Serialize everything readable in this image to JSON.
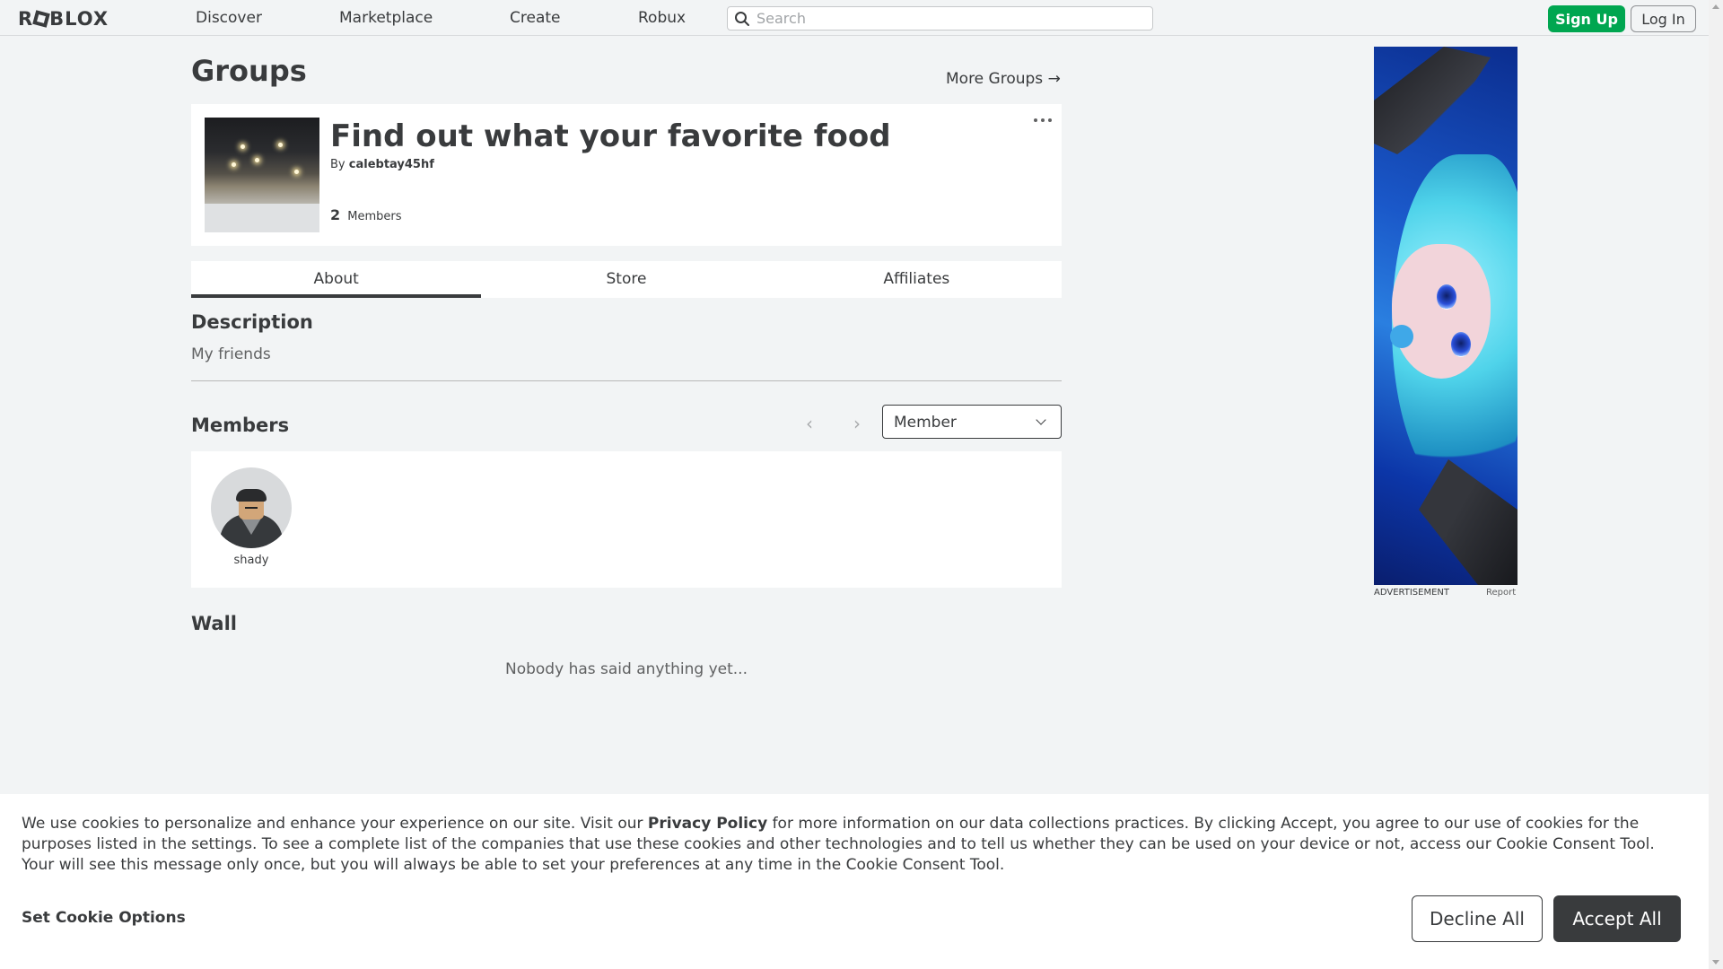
{
  "nav": {
    "logo": "ROBLOX",
    "links": [
      "Discover",
      "Marketplace",
      "Create",
      "Robux"
    ],
    "search_placeholder": "Search",
    "signup_label": "Sign Up",
    "login_label": "Log In"
  },
  "page": {
    "title": "Groups",
    "more_groups": "More Groups →"
  },
  "group": {
    "name": "Find out what your favorite food",
    "by_prefix": "By",
    "owner": "calebtay45hf",
    "member_count": "2",
    "members_label": "Members"
  },
  "tabs": [
    {
      "label": "About",
      "active": true
    },
    {
      "label": "Store",
      "active": false
    },
    {
      "label": "Affiliates",
      "active": false
    }
  ],
  "description": {
    "heading": "Description",
    "text": "My friends"
  },
  "members": {
    "heading": "Members",
    "role_selected": "Member",
    "list": [
      {
        "name": "shady"
      }
    ]
  },
  "wall": {
    "heading": "Wall",
    "empty_text": "Nobody has said anything yet..."
  },
  "ad": {
    "label": "ADVERTISEMENT",
    "report": "Report"
  },
  "cookie": {
    "text_before": "We use cookies to personalize and enhance your experience on our site. Visit our ",
    "policy_link": "Privacy Policy",
    "text_after": " for more information on our data collections practices. By clicking Accept, you agree to our use of cookies for the purposes listed in the settings. To see a complete list of the companies that use these cookies and other technologies and to tell us whether they can be used on your device or not, access our Cookie Consent Tool. Your will see this message only once, but you will always be able to set your preferences at any time in the Cookie Consent Tool.",
    "options_label": "Set Cookie Options",
    "decline_label": "Decline All",
    "accept_label": "Accept All"
  },
  "colors": {
    "accent_green": "#00a650",
    "text": "#393b3d",
    "background": "#f2f4f5"
  }
}
